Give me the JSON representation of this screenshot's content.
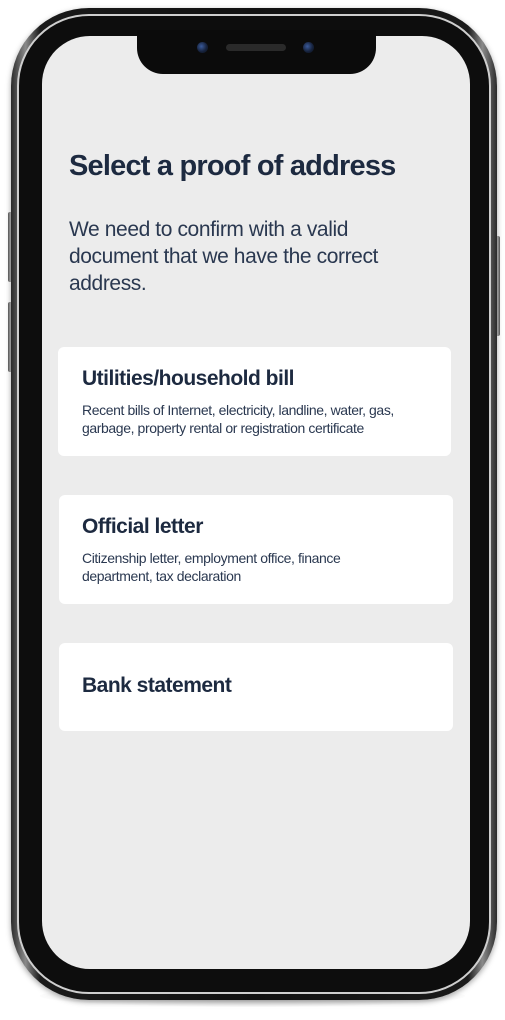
{
  "screen": {
    "title": "Select a proof of address",
    "subtitle": "We need to confirm with a valid document that we have the correct address."
  },
  "options": [
    {
      "title": "Utilities/household bill",
      "description": "Recent bills of Internet, electricity, landline, water, gas, garbage, property rental or registration certificate"
    },
    {
      "title": "Official letter",
      "description": "Citizenship letter, employment office, finance department, tax declaration"
    },
    {
      "title": "Bank statement",
      "description": ""
    }
  ],
  "colors": {
    "screen_background": "#ececec",
    "card_background": "#ffffff",
    "heading_text": "#1d2a40",
    "body_text": "#2a3850",
    "phone_frame": "#111111"
  }
}
